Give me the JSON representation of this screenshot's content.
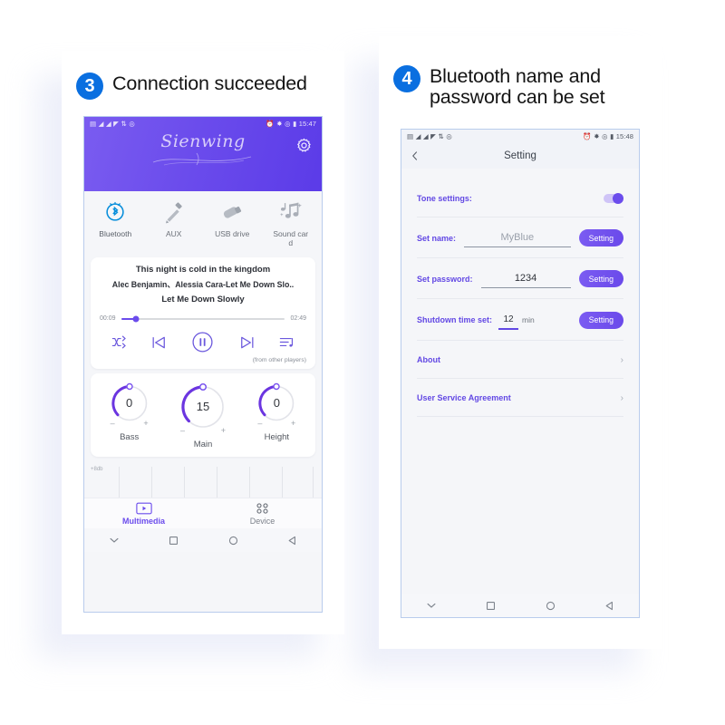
{
  "steps": {
    "left": {
      "number": "3",
      "title": "Connection succeeded"
    },
    "right": {
      "number": "4",
      "title": "Bluetooth name and\npassword can be set"
    }
  },
  "colors": {
    "badge_blue": "#0a6fe0",
    "accent_purple": "#6b4cec",
    "header_gradient_start": "#7a5cf0",
    "header_gradient_end": "#5b3be8",
    "label_purple": "#6248e4",
    "panel_bg": "#f5f6f9"
  },
  "left_phone": {
    "statusbar": {
      "left_icons": [
        "sim-card-icon",
        "signal-1-icon",
        "signal-2-icon",
        "wifi-icon",
        "data-transfer-icon",
        "location-icon"
      ],
      "right_icons": [
        "alarm-icon",
        "bluetooth-icon",
        "gps-icon",
        "battery-icon"
      ],
      "time": "15:47"
    },
    "header": {
      "brand": "Sienwing",
      "gear_label": "settings"
    },
    "sources": [
      {
        "label": "Bluetooth",
        "icon": "bluetooth-icon",
        "active": true
      },
      {
        "label": "AUX",
        "icon": "aux-plug-icon",
        "active": false
      },
      {
        "label": "USB drive",
        "icon": "usb-drive-icon",
        "active": false
      },
      {
        "label": "Sound card",
        "icon": "music-notes-icon",
        "active": false
      }
    ],
    "track": {
      "line1": "This night is cold in the kingdom",
      "line2": "Alec Benjamin、Alessia Cara-Let Me Down Slo..",
      "line3": "Let Me Down Slowly",
      "elapsed": "00:09",
      "duration": "02:49",
      "progress_percent": 9,
      "from_note": "(from other players)",
      "controls": [
        "shuffle-icon",
        "previous-track-icon",
        "pause-icon",
        "next-track-icon",
        "playlist-icon"
      ]
    },
    "knobs": [
      {
        "label": "Bass",
        "value": "0",
        "minus": "–",
        "plus": "+",
        "arc_percent": 50
      },
      {
        "label": "Main",
        "value": "15",
        "minus": "–",
        "plus": "+",
        "arc_percent": 55
      },
      {
        "label": "Height",
        "value": "0",
        "minus": "–",
        "plus": "+",
        "arc_percent": 50
      }
    ],
    "eq": {
      "db_label": "+8db",
      "gridlines": 7
    },
    "tabs": [
      {
        "label": "Multimedia",
        "icon": "media-play-icon",
        "active": true
      },
      {
        "label": "Device",
        "icon": "grid-device-icon",
        "active": false
      }
    ],
    "navbar": [
      "chevron-down-icon",
      "square-icon",
      "circle-icon",
      "back-triangle-icon"
    ]
  },
  "right_phone": {
    "statusbar": {
      "left_icons": [
        "sim-card-icon",
        "signal-1-icon",
        "signal-2-icon",
        "wifi-icon",
        "data-transfer-icon",
        "location-icon"
      ],
      "right_icons": [
        "alarm-icon",
        "bluetooth-icon",
        "gps-icon",
        "battery-icon"
      ],
      "time": "15:48"
    },
    "header": {
      "title": "Setting",
      "back_icon": "back-chevron-icon"
    },
    "rows": [
      {
        "label": "Tone settings:",
        "type": "toggle",
        "on": true
      },
      {
        "label": "Set name:",
        "type": "field-button",
        "value": "MyBlue",
        "button": "Setting",
        "placeholder": true
      },
      {
        "label": "Set password:",
        "type": "field-button",
        "value": "1234",
        "button": "Setting",
        "placeholder": false
      },
      {
        "label": "Shutdown time set:",
        "type": "stepper-button",
        "value": "12",
        "unit": "min",
        "button": "Setting"
      },
      {
        "label": "About",
        "type": "link"
      },
      {
        "label": "User Service Agreement",
        "type": "link"
      }
    ],
    "navbar": [
      "chevron-down-icon",
      "square-icon",
      "circle-icon",
      "back-triangle-icon"
    ]
  }
}
